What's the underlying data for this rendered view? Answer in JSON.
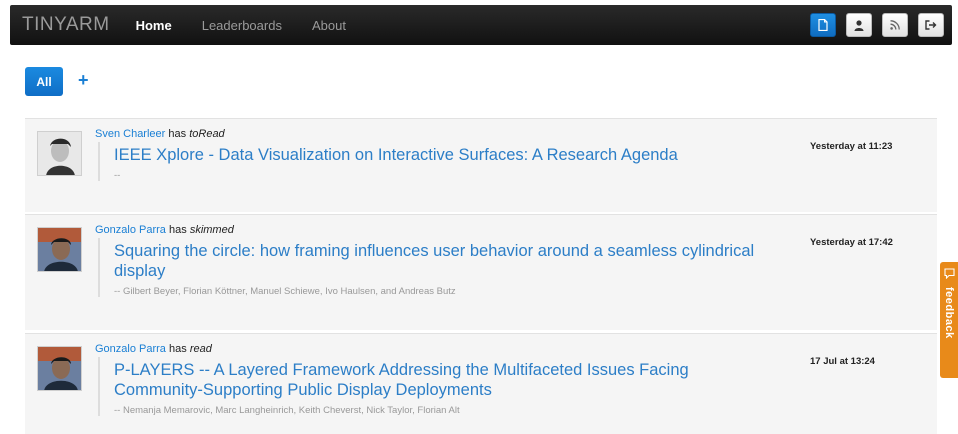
{
  "navbar": {
    "brand": "TINYARM",
    "links": [
      {
        "label": "Home",
        "active": true
      },
      {
        "label": "Leaderboards",
        "active": false
      },
      {
        "label": "About",
        "active": false
      }
    ],
    "right_buttons": [
      {
        "icon": "document-icon"
      },
      {
        "icon": "user-icon"
      },
      {
        "icon": "rss-icon"
      },
      {
        "icon": "sign-out-icon"
      }
    ]
  },
  "filters": {
    "all_label": "All",
    "add_label": "+"
  },
  "feed": [
    {
      "actor": "Sven Charleer",
      "has": "has",
      "verb": "toRead",
      "title": "IEEE Xplore - Data Visualization on Interactive Surfaces: A Research Agenda",
      "authors": "--",
      "timestamp": "Yesterday at 11:23"
    },
    {
      "actor": "Gonzalo Parra",
      "has": "has",
      "verb": "skimmed",
      "title": "Squaring the circle: how framing influences user behavior around a seamless cylindrical display",
      "authors": "-- Gilbert Beyer, Florian Köttner, Manuel Schiewe, Ivo Haulsen, and Andreas Butz",
      "timestamp": "Yesterday at 17:42"
    },
    {
      "actor": "Gonzalo Parra",
      "has": "has",
      "verb": "read",
      "title": "P-LAYERS -- A Layered Framework Addressing the Multifaceted Issues Facing Community-Supporting Public Display Deployments",
      "authors": "-- Nemanja Memarovic, Marc Langheinrich, Keith Cheverst, Nick Taylor, Florian Alt",
      "timestamp": "17 Jul at 13:24"
    }
  ],
  "feedback": {
    "label": "feedback"
  },
  "colors": {
    "link": "#2c7ec7",
    "primary": "#1a7fd4",
    "feedback": "#e88a1a"
  }
}
